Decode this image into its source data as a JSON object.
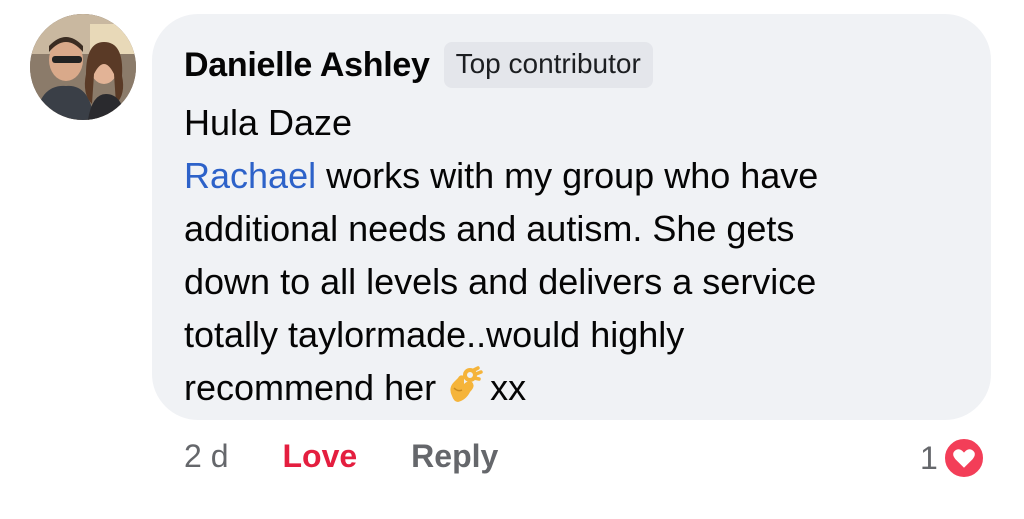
{
  "comment": {
    "author": "Danielle Ashley",
    "badge": "Top contributor",
    "lines": [
      {
        "text": "Hula Daze"
      },
      {
        "mention": "Rachael",
        "text": " works with my group who have"
      },
      {
        "text": "additional needs and autism. She gets"
      },
      {
        "text": "down to all levels and delivers a service"
      },
      {
        "text": "totally taylormade..would highly"
      },
      {
        "text": "recommend her",
        "emoji": "ok-hand-emoji",
        "suffix": "xx"
      }
    ],
    "colors": {
      "mention": "#2d62c9",
      "love": "#e41e3f",
      "bubble": "#f0f2f5"
    }
  },
  "actions": {
    "time": "2 d",
    "love": "Love",
    "reply": "Reply"
  },
  "reactions": {
    "count": "1",
    "icon": "heart-icon"
  }
}
